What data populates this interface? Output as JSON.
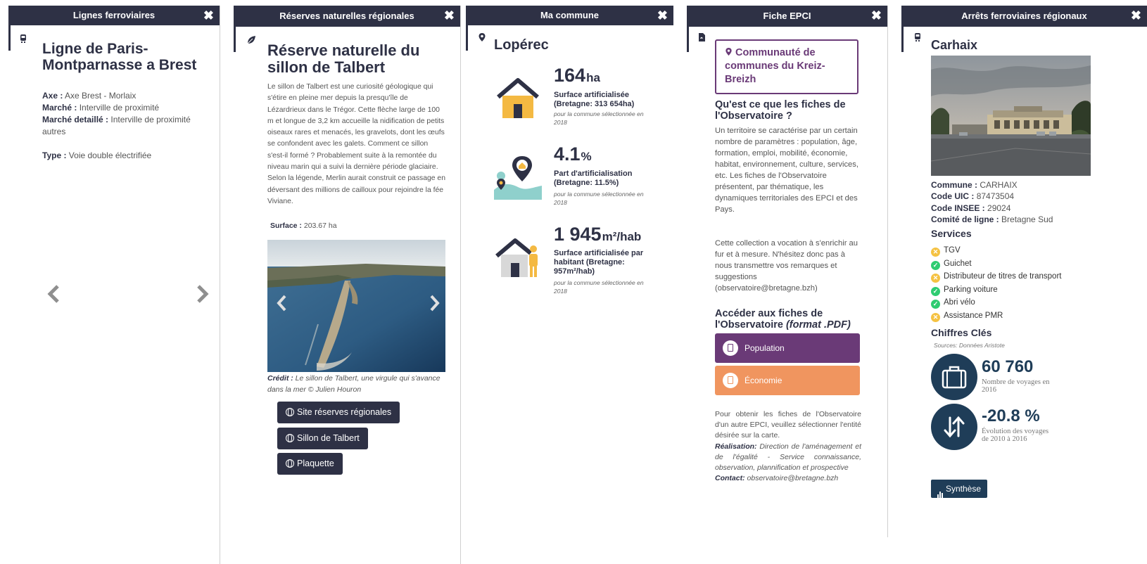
{
  "panel1": {
    "title": "Lignes ferroviaires",
    "close": "✖",
    "heading": "Ligne de Paris-Montparnasse a Brest",
    "axe_label": "Axe :",
    "axe_value": "Axe Brest - Morlaix",
    "marche_label": "Marché :",
    "marche_value": "Interville de proximité",
    "marche_detail_label": "Marché detaillé :",
    "marche_detail_value": "Interville de proximité autres",
    "type_label": "Type :",
    "type_value": "Voie double électrifiée",
    "prev": "‹",
    "next": "›"
  },
  "panel2": {
    "title": "Réserves naturelles régionales",
    "close": "✖",
    "heading": "Réserve naturelle du sillon de Talbert",
    "description": "Le sillon de Talbert est une curiosité géologique qui s'étire en pleine mer depuis la presqu'île de Lézardrieux dans le Trégor. Cette flèche large de 100 m et longue de 3,2 km accueille la nidification de petits oiseaux rares et menacés, les gravelots, dont les œufs se confondent avec les galets. Comment ce sillon s'est-il formé ? Probablement suite à la remontée du niveau marin qui a suivi la dernière période glaciaire. Selon la légende, Merlin aurait construit ce passage en déversant des millions de cailloux pour rejoindre la fée Viviane.",
    "surface_label": "Surface :",
    "surface_value": "203.67 ha",
    "credit_label": "Crédit :",
    "credit_value": "Le sillon de Talbert, une virgule qui s'avance dans la mer © Julien Houron",
    "buttons": [
      "Site réserves régionales",
      "Sillon de Talbert",
      "Plaquette"
    ],
    "prev": "‹",
    "next": "›"
  },
  "panel3": {
    "title": "Ma commune",
    "close": "✖",
    "commune": "Lopérec",
    "stats": [
      {
        "value": "164",
        "unit": "ha",
        "label": "Surface artificialisée (Bretagne: 313 654ha)",
        "note": "pour la commune sélectionnée en 2018",
        "icon": "house-icon"
      },
      {
        "value": "4.1",
        "unit": "%",
        "label": "Part d'artificialisation (Bretagne: 11.5%)",
        "note": "pour la commune sélectionnée en 2018",
        "icon": "map-pin-landscape-icon"
      },
      {
        "value": "1 945",
        "unit": "m²/hab",
        "label": "Surface artificialisée par habitant (Bretagne: 957m²/hab)",
        "note": "pour la commune sélectionnée en 2018",
        "icon": "house-person-icon"
      }
    ]
  },
  "panel4": {
    "title": "Fiche EPCI",
    "close": "✖",
    "entity": "Communauté de communes du Kreiz-Breizh",
    "q_heading": "Qu'est ce que les fiches de l'Observatoire ?",
    "q_text": "Un territoire se caractérise par un certain nombre de paramètres : population, âge, formation, emploi, mobilité, économie, habitat, environnement, culture, services, etc. Les fiches de l'Observatoire présentent, par thématique, les dynamiques territoriales des EPCI et des Pays.",
    "q_text2": "Cette collection a vocation à s'enrichir au fur et à mesure. N'hésitez donc pas à nous transmettre vos remarques et suggestions (observatoire@bretagne.bzh)",
    "acc_heading": "Accéder aux fiches de l'Observatoire",
    "acc_format": "(format .PDF)",
    "btn_population": "Population",
    "btn_economie": "Économie",
    "foot_text": "Pour obtenir les fiches de l'Observatoire d'un autre EPCI, veuillez sélectionner l'entité désirée sur la carte.",
    "real_label": "Réalisation:",
    "real_value": "Direction de l'aménagement et de l'égalité - Service connaissance, observation, plannification et prospective",
    "contact_label": "Contact:",
    "contact_value": "observatoire@bretagne.bzh"
  },
  "panel5": {
    "title": "Arrêts ferroviaires régionaux",
    "close": "✖",
    "station": "Carhaix",
    "commune_label": "Commune :",
    "commune_value": "CARHAIX",
    "uic_label": "Code UIC :",
    "uic_value": "87473504",
    "insee_label": "Code INSEE :",
    "insee_value": "29024",
    "comite_label": "Comité de ligne :",
    "comite_value": "Bretagne Sud",
    "services_heading": "Services",
    "services": [
      {
        "label": "TGV",
        "status": "no"
      },
      {
        "label": "Guichet",
        "status": "yes"
      },
      {
        "label": "Distributeur de titres de transport",
        "status": "no"
      },
      {
        "label": "Parking voiture",
        "status": "yes"
      },
      {
        "label": "Abri vélo",
        "status": "yes"
      },
      {
        "label": "Assistance PMR",
        "status": "no"
      }
    ],
    "chiffres_heading": "Chiffres Clés",
    "source": "Sources: Données Aristote",
    "kpi1_value": "60 760",
    "kpi1_desc": "Nombre de voyages en 2016",
    "kpi2_value": "-20.8 %",
    "kpi2_desc": "Évolution des voyages de 2010 à 2016",
    "synthese": "Synthèse"
  },
  "colors": {
    "header": "#2e3145",
    "purple": "#6a3a77",
    "orange": "#f0955f",
    "navy": "#1f3d58",
    "house": "#f4b942",
    "teal": "#8fd0cc",
    "ok": "#2ecc71",
    "ko": "#f5c242"
  }
}
